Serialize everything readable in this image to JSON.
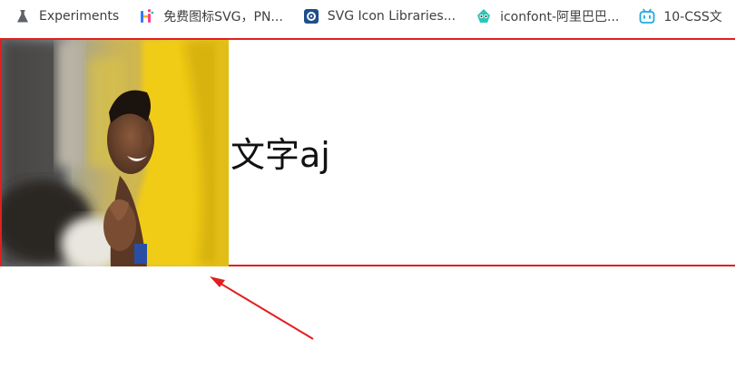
{
  "bookmarks": [
    {
      "label": "Experiments",
      "icon": "flask-icon"
    },
    {
      "label": "免费图标SVG，PN...",
      "icon": "iconfont-hi-icon"
    },
    {
      "label": "SVG Icon Libraries...",
      "icon": "svg-libraries-icon"
    },
    {
      "label": "iconfont-阿里巴巴...",
      "icon": "iconfont-mascot-icon"
    },
    {
      "label": "10-CSS文",
      "icon": "bilibili-tv-icon"
    }
  ],
  "content": {
    "caption": "文字aj",
    "image": "photo of smiling football player in yellow jersey"
  },
  "colors": {
    "box_border": "#e0201f",
    "arrow": "#e0201f"
  }
}
